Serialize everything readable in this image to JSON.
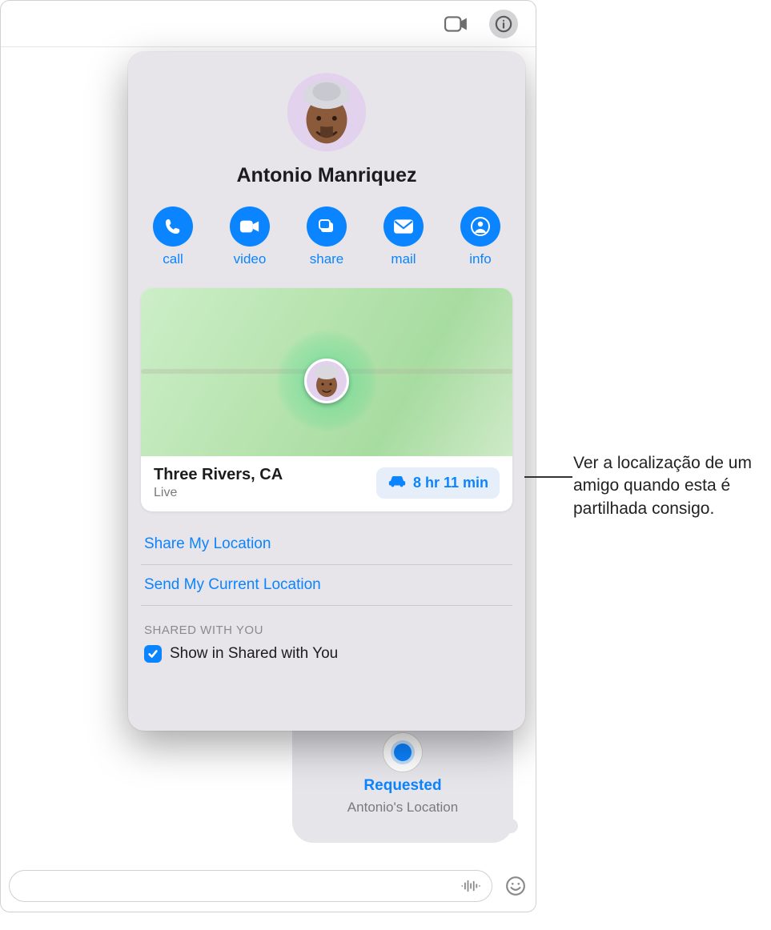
{
  "contact": {
    "name": "Antonio Manriquez"
  },
  "actions": {
    "call": "call",
    "video": "video",
    "share": "share",
    "mail": "mail",
    "info": "info"
  },
  "location": {
    "place": "Three Rivers, CA",
    "status": "Live",
    "driveTime": "8 hr 11 min"
  },
  "links": {
    "shareMyLocation": "Share My Location",
    "sendCurrentLocation": "Send My Current Location"
  },
  "sharedSection": {
    "header": "SHARED WITH YOU",
    "checkboxLabel": "Show in Shared with You"
  },
  "messageBubble": {
    "title": "Requested",
    "subtitle": "Antonio's Location"
  },
  "callout": {
    "text": "Ver a localização de um amigo quando esta é partilhada consigo."
  }
}
